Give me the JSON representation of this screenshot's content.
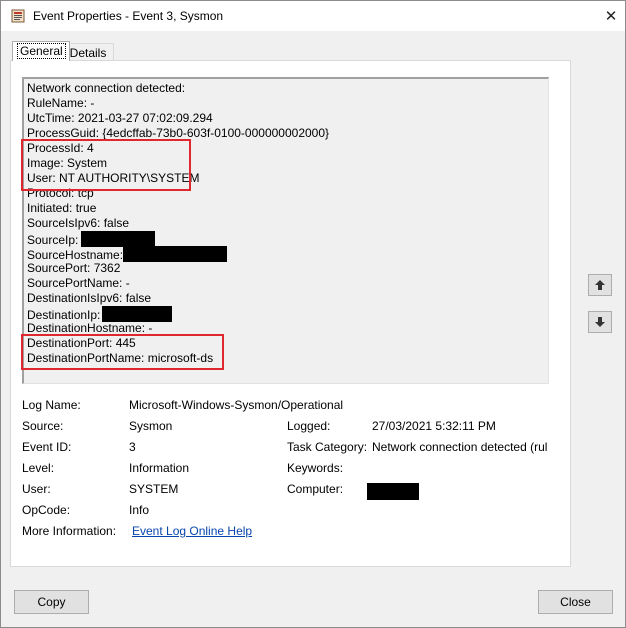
{
  "window": {
    "title": "Event Properties - Event 3, Sysmon"
  },
  "tabs": {
    "general": "General",
    "details": "Details"
  },
  "event_text": [
    "Network connection detected:",
    "RuleName: -",
    "UtcTime: 2021-03-27 07:02:09.294",
    "ProcessGuid: {4edcffab-73b0-603f-0100-000000002000}",
    "ProcessId: 4",
    "Image: System",
    "User: NT AUTHORITY\\SYSTEM",
    "Protocol: tcp",
    "Initiated: true",
    "SourceIsIpv6: false",
    "SourceIp:",
    "SourceHostname:",
    "SourcePort: 7362",
    "SourcePortName: -",
    "DestinationIsIpv6: false",
    "DestinationIp:",
    "DestinationHostname: -",
    "DestinationPort: 445",
    "DestinationPortName: microsoft-ds"
  ],
  "fields": {
    "log_name_label": "Log Name:",
    "log_name_value": "Microsoft-Windows-Sysmon/Operational",
    "source_label": "Source:",
    "source_value": "Sysmon",
    "logged_label": "Logged:",
    "logged_value": "27/03/2021 5:32:11 PM",
    "event_id_label": "Event ID:",
    "event_id_value": "3",
    "task_category_label": "Task Category:",
    "task_category_value": "Network connection detected (rul",
    "level_label": "Level:",
    "level_value": "Information",
    "keywords_label": "Keywords:",
    "user_label": "User:",
    "user_value": "SYSTEM",
    "computer_label": "Computer:",
    "opcode_label": "OpCode:",
    "opcode_value": "Info",
    "more_info_label": "More Information:",
    "more_info_link": "Event Log Online Help"
  },
  "buttons": {
    "copy": "Copy",
    "close": "Close"
  },
  "icons": {
    "up": "arrow-up-icon",
    "down": "arrow-down-icon",
    "close": "close-icon"
  },
  "colors": {
    "highlight": "#e0272f",
    "link": "#0645ad"
  }
}
